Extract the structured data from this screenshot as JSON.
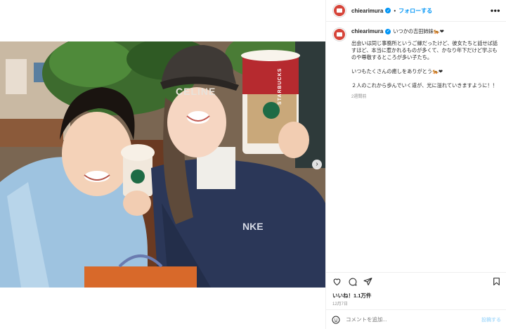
{
  "post": {
    "username": "chiearimura",
    "follow_label": "フォローする",
    "more_label": "•••",
    "dot": "•",
    "verified_mark": "✓"
  },
  "caption": {
    "username": "chiearimura",
    "title": "いつかの吉田姉妹🐅❤",
    "paragraphs": [
      "出会いは同じ事務所というご縁だったけど、彼女たちと話せば話すほど、本当に惹かれるものが多くて、かなり年下だけど学ぶものや尊敬するところが多い子たち。",
      "いつもたくさんの癒しをありがとう🐅❤",
      "２人のこれから歩んでいく道が、光に溢れていきますように！！"
    ],
    "time_ago": "2週間前"
  },
  "engagement": {
    "likes": "いいね！1.1万件",
    "date": "12月7日"
  },
  "comment": {
    "placeholder": "コメントを追加...",
    "post_label": "投稿する"
  },
  "photo": {
    "cap_text": "CELINE",
    "cup_brand": "STARBUCKS",
    "sweat_text": "NKE",
    "next_arrow": "›"
  },
  "icons": {
    "like": "heart-icon",
    "comment": "comment-icon",
    "share": "share-icon",
    "save": "bookmark-icon",
    "emoji": "smiley-icon"
  },
  "colors": {
    "accent": "#0095f6",
    "avatar": "#d6453a",
    "muted": "#8e8e8e"
  }
}
